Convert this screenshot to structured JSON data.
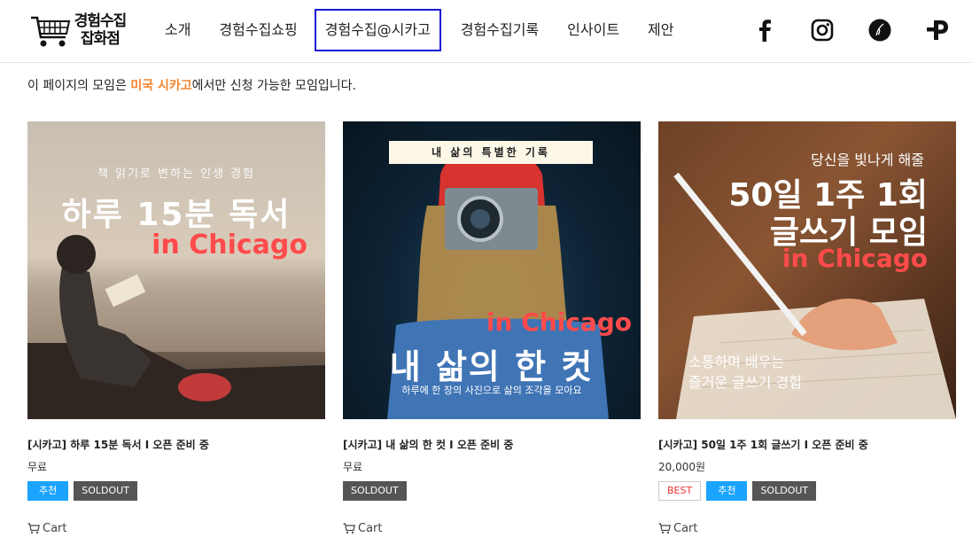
{
  "brand": {
    "line1": "경험수집",
    "line2": "잡화점"
  },
  "nav": [
    {
      "label": "소개"
    },
    {
      "label": "경험수집쇼핑"
    },
    {
      "label": "경험수집@시카고"
    },
    {
      "label": "경험수집기록"
    },
    {
      "label": "인사이트"
    },
    {
      "label": "제안"
    }
  ],
  "social": [
    "facebook-icon",
    "instagram-icon",
    "brunch-icon",
    "postype-icon"
  ],
  "notice": {
    "before": "이 페이지의 모임은 ",
    "highlight": "미국 시카고",
    "after": "에서만 신청 가능한 모임입니다."
  },
  "products": [
    {
      "image": {
        "top": "책 읽기로 변하는 인생 경험",
        "main": "하루 15분 독서",
        "accent": "in Chicago"
      },
      "title": "[시카고] 하루 15분 독서 I 오픈 준비 중",
      "price": "무료",
      "badges": [
        "추천",
        "SOLDOUT"
      ],
      "cart": "Cart"
    },
    {
      "image": {
        "banner": "내 삶의 특별한 기록",
        "accent": "in Chicago",
        "main": "내 삶의 한 컷",
        "sub": "하루에 한 장의 사진으로 삶의 조각을 모아요"
      },
      "title": "[시카고] 내 삶의 한 컷 I 오픈 준비 중",
      "price": "무료",
      "badges": [
        "SOLDOUT"
      ],
      "cart": "Cart"
    },
    {
      "image": {
        "top": "당신을 빛나게 해줄",
        "main1": "50일 1주 1회",
        "main2": "글쓰기 모임",
        "accent": "in Chicago",
        "sub1": "소통하며 배우는",
        "sub2": "즐거운 글쓰기 경험"
      },
      "title": "[시카고] 50일 1주 1회 글쓰기 I 오픈 준비 중",
      "price": "20,000원",
      "badges": [
        "BEST",
        "추천",
        "SOLDOUT"
      ],
      "cart": "Cart"
    }
  ],
  "colors": {
    "accent_orange": "#f5832a",
    "nav_active_outline": "#1a1ad6",
    "badge_rec": "#1aa3ff",
    "badge_sold": "#555555",
    "badge_best_text": "#ee3333",
    "chicago_red": "#ff4b4b"
  }
}
